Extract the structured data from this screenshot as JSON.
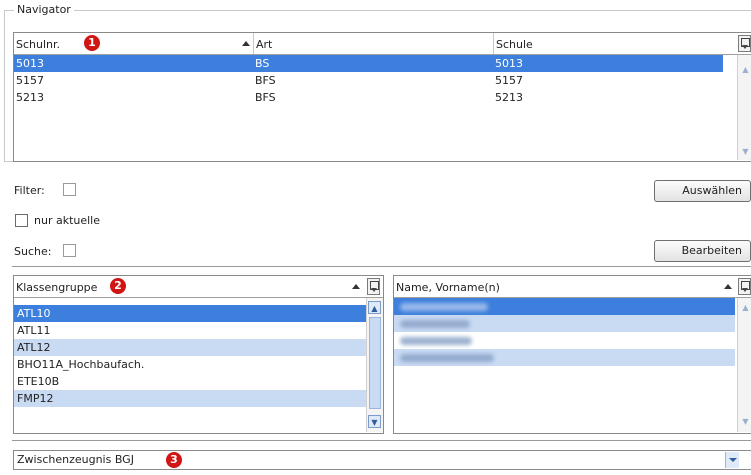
{
  "navigator": {
    "title": "Navigator",
    "columns": [
      "Schulnr.",
      "Art",
      "Schule"
    ],
    "rows": [
      {
        "schulnr": "5013",
        "art": "BS",
        "schule": "5013",
        "selected": true
      },
      {
        "schulnr": "5157",
        "art": "BFS",
        "schule": "5157",
        "selected": false
      },
      {
        "schulnr": "5213",
        "art": "BFS",
        "schule": "5213",
        "selected": false
      }
    ]
  },
  "badges": [
    "1",
    "2",
    "3"
  ],
  "form": {
    "filter_label": "Filter:",
    "nur_aktuelle_label": "nur aktuelle",
    "suche_label": "Suche:",
    "auswaehlen_button": "Auswählen",
    "bearbeiten_button": "Bearbeiten"
  },
  "klassen": {
    "header": "Klassengruppe",
    "rows": [
      {
        "label": "ATL10",
        "selected": true
      },
      {
        "label": "ATL11",
        "selected": false
      },
      {
        "label": "ATL12",
        "selected": false
      },
      {
        "label": "BHO11A_Hochbaufach.",
        "selected": false
      },
      {
        "label": "ETE10B",
        "selected": false
      },
      {
        "label": "FMP12",
        "selected": false
      }
    ]
  },
  "students": {
    "header": "Name, Vorname(n)",
    "row_count": 4
  },
  "zeugnis": {
    "selected": "Zwischenzeugnis BGJ"
  },
  "colors": {
    "selection": "#3d7fdc",
    "alt_row": "#c9daf3",
    "badge": "#d11414"
  }
}
